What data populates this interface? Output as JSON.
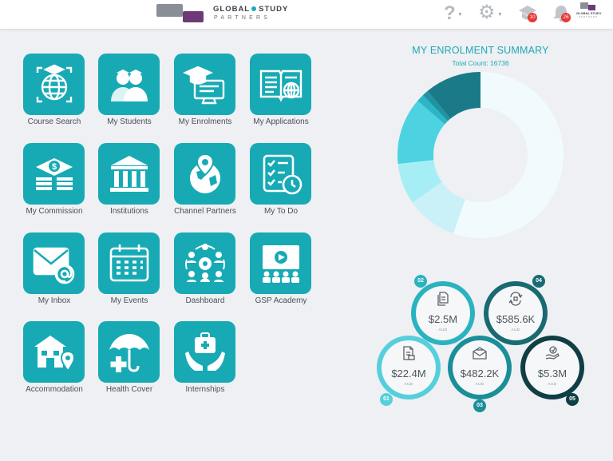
{
  "brand": {
    "line1_a": "GLOBAL",
    "line1_b": "STUDY",
    "line2": "PARTNERS",
    "mini_line1": "GLOBAL STUDY",
    "mini_line2": "PARTNERS"
  },
  "header": {
    "help_icon": "question-icon",
    "settings_icon": "gear-icon",
    "notifications_a": {
      "icon": "graduation-bell-icon",
      "count": "10"
    },
    "notifications_b": {
      "icon": "bell-icon",
      "count": "26"
    }
  },
  "tiles": [
    {
      "label": "Course Search",
      "icon": "globe-grad-icon"
    },
    {
      "label": "My Students",
      "icon": "students-icon"
    },
    {
      "label": "My Enrolments",
      "icon": "enrolments-icon"
    },
    {
      "label": "My Applications",
      "icon": "applications-icon"
    },
    {
      "label": "My Commission",
      "icon": "commission-icon"
    },
    {
      "label": "Institutions",
      "icon": "institution-icon"
    },
    {
      "label": "Channel Partners",
      "icon": "channel-partners-icon"
    },
    {
      "label": "My To Do",
      "icon": "todo-icon"
    },
    {
      "label": "My Inbox",
      "icon": "inbox-icon"
    },
    {
      "label": "My Events",
      "icon": "calendar-icon"
    },
    {
      "label": "Dashboard",
      "icon": "dashboard-icon"
    },
    {
      "label": "GSP Academy",
      "icon": "academy-icon"
    },
    {
      "label": "Accommodation",
      "icon": "accommodation-icon"
    },
    {
      "label": "Health Cover",
      "icon": "health-cover-icon"
    },
    {
      "label": "Internships",
      "icon": "internships-icon"
    }
  ],
  "summary": {
    "title": "MY ENROLMENT SUMMARY",
    "count_label": "Total Count: 16736",
    "colors": [
      "#f1fbfd",
      "#c9f1f7",
      "#a6eef5",
      "#4dd2e2",
      "#2bb6c8",
      "#1f93a2",
      "#1b7a88"
    ],
    "segments": [
      0.553,
      0.1,
      0.08,
      0.13,
      0.015,
      0.012,
      0.11
    ]
  },
  "bubbles": [
    {
      "num": "01",
      "amount": "$22.4M",
      "currency": "AUD",
      "color": "#55cfdb",
      "icon": "document-icon"
    },
    {
      "num": "02",
      "amount": "$2.5M",
      "currency": "AUD",
      "color": "#2ab3bf",
      "icon": "documents-icon"
    },
    {
      "num": "03",
      "amount": "$482.2K",
      "currency": "AUD",
      "color": "#1a8f99",
      "icon": "envelope-icon"
    },
    {
      "num": "04",
      "amount": "$585.6K",
      "currency": "AUD",
      "color": "#196a72",
      "icon": "cycle-icon"
    },
    {
      "num": "05",
      "amount": "$5.3M",
      "currency": "AUD",
      "color": "#0f3f44",
      "icon": "handshake-icon"
    }
  ]
}
